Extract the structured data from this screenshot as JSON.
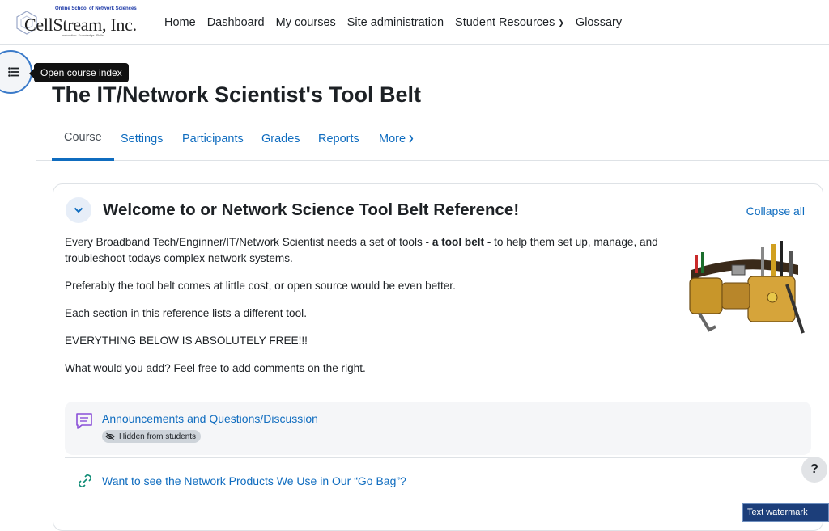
{
  "brand": {
    "tagline": "Online School of Network Sciences",
    "name": "CellStream, Inc.",
    "motto": "Instruction. Knowledge. Skills."
  },
  "nav": {
    "items": [
      {
        "label": "Home"
      },
      {
        "label": "Dashboard"
      },
      {
        "label": "My courses"
      },
      {
        "label": "Site administration"
      },
      {
        "label": "Student Resources"
      },
      {
        "label": "Glossary"
      }
    ]
  },
  "drawer": {
    "icon": "list-icon",
    "tooltip": "Open course index"
  },
  "course": {
    "title": "The IT/Network Scientist's Tool Belt"
  },
  "tabs": [
    {
      "label": "Course"
    },
    {
      "label": "Settings"
    },
    {
      "label": "Participants"
    },
    {
      "label": "Grades"
    },
    {
      "label": "Reports"
    },
    {
      "label": "More"
    }
  ],
  "section": {
    "title": "Welcome to or Network Science Tool Belt Reference!",
    "collapse_all": "Collapse all",
    "summary": {
      "p1_before": "Every Broadband Tech/Enginner/IT/Network Scientist needs a set of tools - ",
      "p1_bold": "a tool belt",
      "p1_after": " - to help them set up, manage, and troubleshoot todays complex network systems.",
      "p2": "Preferably the tool belt comes at little cost, or open source would be even better.",
      "p3": "Each section in this reference lists a different tool.",
      "p4": "EVERYTHING BELOW IS ABSOLUTELY FREE!!!",
      "p5": "What would you add?  Feel free to add comments on the right."
    }
  },
  "activities": [
    {
      "label": "Announcements and Questions/Discussion",
      "badge": "Hidden from students",
      "icon": "forum-icon"
    },
    {
      "label": "Want to see the Network Products We Use in Our “Go Bag”?",
      "icon": "url-link-icon"
    }
  ],
  "help": {
    "label": "?"
  },
  "watermark": "Text watermark",
  "colors": {
    "link": "#0f6cbf",
    "forum_icon": "#8a4fd8",
    "url_icon": "#0d8a74",
    "drawer_ring": "#3a7ac9"
  }
}
